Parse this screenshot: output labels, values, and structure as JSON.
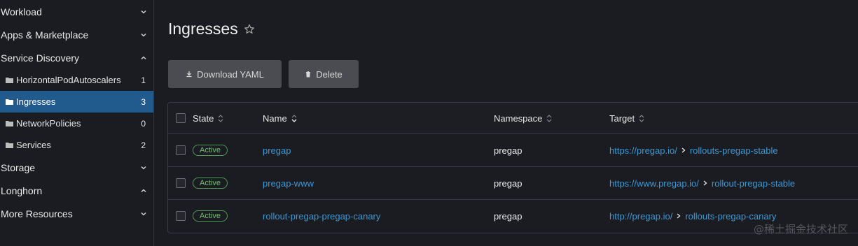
{
  "sidebar": {
    "groups": [
      {
        "label": "Workload",
        "chevron": "chevron-down-icon"
      },
      {
        "label": "Apps & Marketplace",
        "chevron": "chevron-down-icon"
      },
      {
        "label": "Service Discovery",
        "chevron": "chevron-up-icon"
      },
      {
        "label": "Storage",
        "chevron": "chevron-down-icon"
      },
      {
        "label": "Longhorn",
        "chevron": "chevron-up-icon"
      },
      {
        "label": "More Resources",
        "chevron": "chevron-down-icon"
      }
    ],
    "items": [
      {
        "label": "HorizontalPodAutoscalers",
        "count": "1",
        "icon": "folder-icon"
      },
      {
        "label": "Ingresses",
        "count": "3",
        "icon": "folder-open-icon",
        "active": true
      },
      {
        "label": "NetworkPolicies",
        "count": "0",
        "icon": "folder-icon"
      },
      {
        "label": "Services",
        "count": "2",
        "icon": "folder-icon"
      }
    ]
  },
  "page": {
    "title": "Ingresses",
    "star_icon": "star-outline-icon"
  },
  "toolbar": {
    "download_label": "Download YAML",
    "download_icon": "download-icon",
    "delete_label": "Delete",
    "delete_icon": "trash-icon"
  },
  "table": {
    "columns": [
      "State",
      "Name",
      "Namespace",
      "Target"
    ],
    "rows": [
      {
        "state": "Active",
        "name": "pregap",
        "namespace": "pregap",
        "target_url": "https://pregap.io/",
        "target_service": "rollouts-pregap-stable"
      },
      {
        "state": "Active",
        "name": "pregap-www",
        "namespace": "pregap",
        "target_url": "https://www.pregap.io/",
        "target_service": "rollout-pregap-stable"
      },
      {
        "state": "Active",
        "name": "rollout-pregap-pregap-canary",
        "namespace": "pregap",
        "target_url": "http://pregap.io/",
        "target_service": "rollouts-pregap-canary"
      }
    ]
  },
  "colors": {
    "accent": "#215a8c",
    "link": "#3d98d3",
    "active_badge": "#6bbf6b",
    "background": "#1b1c21"
  },
  "watermark": "@稀土掘金技术社区"
}
